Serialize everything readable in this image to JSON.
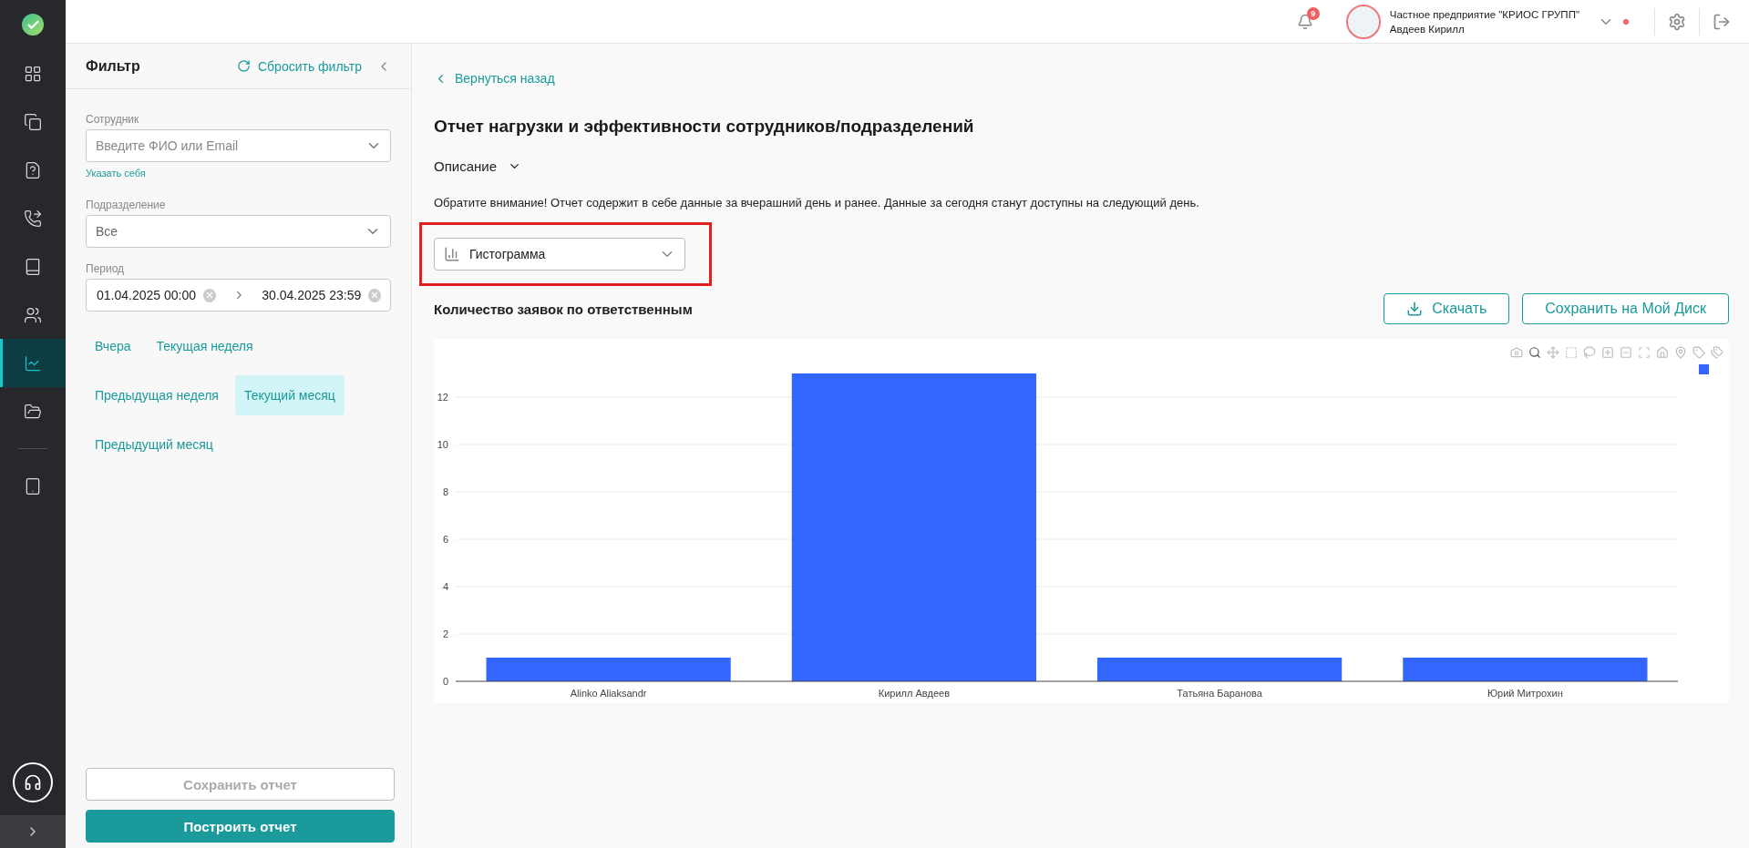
{
  "sidebar": {
    "items": [
      {
        "selected": false
      },
      {
        "selected": false
      },
      {
        "selected": false
      },
      {
        "selected": false
      },
      {
        "selected": false
      },
      {
        "selected": false
      },
      {
        "selected": true
      },
      {
        "selected": false
      },
      {
        "selected": false
      }
    ]
  },
  "header": {
    "notifications": "9",
    "organization": "Частное предприятие \"КРИОС ГРУПП\"",
    "user": "Авдеев Кирилл"
  },
  "filter": {
    "title": "Фильтр",
    "reset": "Сбросить фильтр",
    "employee": {
      "label": "Сотрудник",
      "placeholder": "Введите ФИО или Email"
    },
    "self_link": "Указать себя",
    "department": {
      "label": "Подразделение",
      "value": "Все"
    },
    "period": {
      "label": "Период",
      "from": "01.04.2025 00:00",
      "to": "30.04.2025 23:59"
    },
    "presets": [
      {
        "label": "Вчера",
        "selected": false
      },
      {
        "label": "Текущая неделя",
        "selected": false
      },
      {
        "label": "Предыдущая неделя",
        "selected": false
      },
      {
        "label": "Текущий месяц",
        "selected": true
      },
      {
        "label": "Предыдущий месяц",
        "selected": false
      }
    ],
    "save_button": {
      "label": "Сохранить отчет",
      "disabled": true
    },
    "build_button": {
      "label": "Построить отчет",
      "disabled": false
    }
  },
  "main": {
    "back": "Вернуться назад",
    "title": "Отчет нагрузки и эффективности сотрудников/подразделений",
    "description_toggle": "Описание",
    "notice": "Обратите внимание! Отчет содержит в себе данные за вчерашний день и ранее. Данные за сегодня станут доступны на следующий день.",
    "chart_type": "Гистограмма",
    "chart_title": "Количество заявок по ответственным",
    "download": "Скачать",
    "save_disk": "Сохранить на Мой Диск",
    "chart_data": {
      "type": "bar",
      "categories": [
        "Alinko Aliaksandr",
        "Кирилл Авдеев",
        "Татьяна Баранова",
        "Юрий Митрохин"
      ],
      "series": [
        {
          "color": "#3366ff",
          "values": [
            1,
            13,
            1,
            1
          ]
        }
      ],
      "ylim": [
        0,
        13
      ],
      "yticks": [
        0,
        2,
        4,
        6,
        8,
        10,
        12
      ],
      "grid": true
    }
  }
}
